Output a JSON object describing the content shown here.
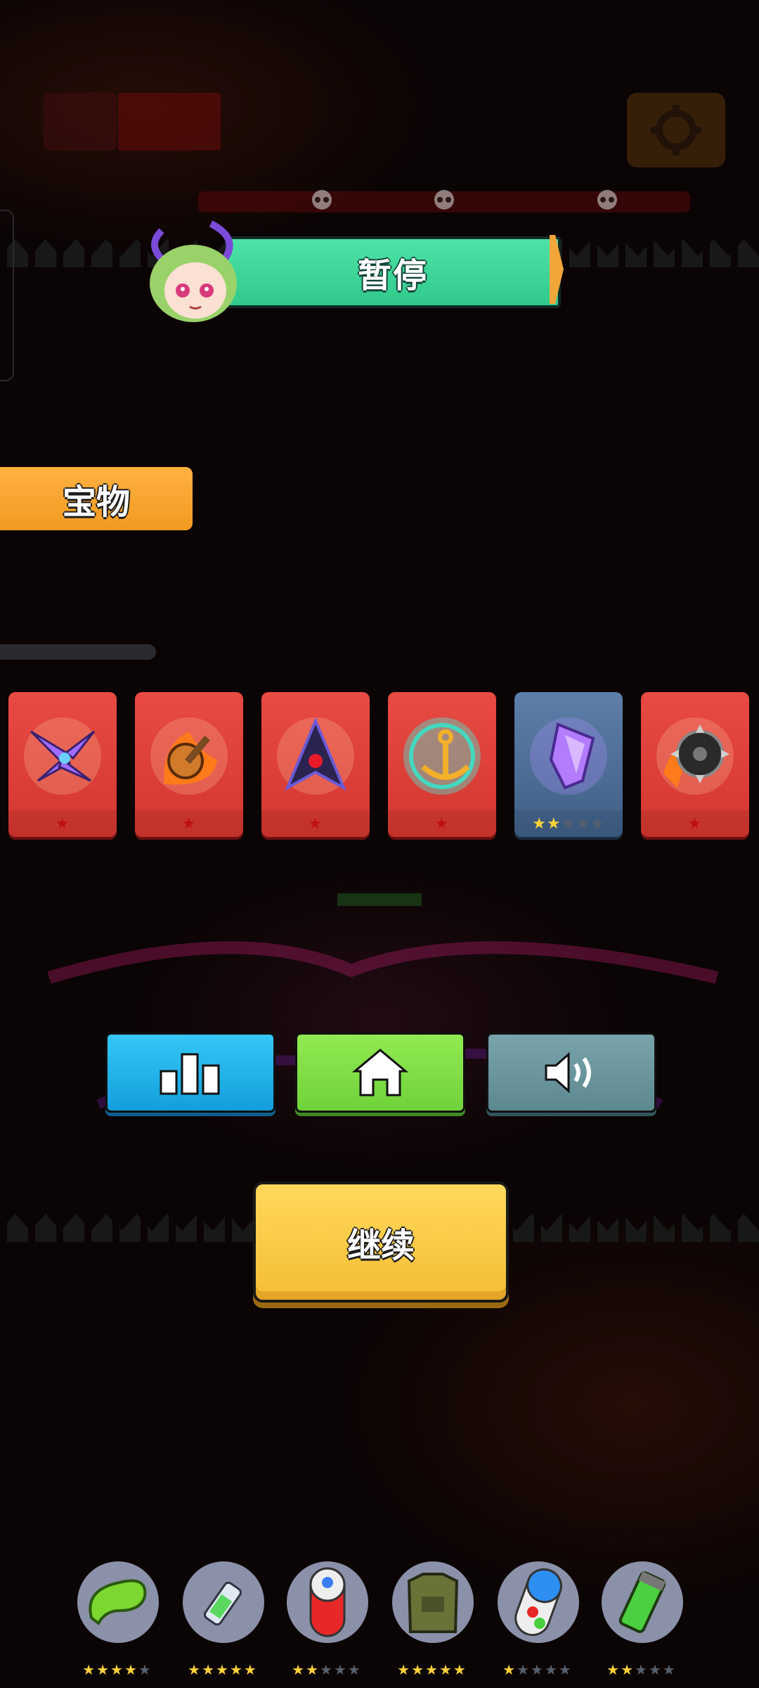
{
  "pause": {
    "title": "暂停"
  },
  "treasure": {
    "tab_label": "宝物"
  },
  "treasure_cards": [
    {
      "name": "purple-claw-icon",
      "stars": 1,
      "max_stars": 1,
      "rarity": "common",
      "accent": "#a06cff"
    },
    {
      "name": "fire-mace-icon",
      "stars": 1,
      "max_stars": 1,
      "rarity": "common",
      "accent": "#ff8a20"
    },
    {
      "name": "dark-spear-icon",
      "stars": 1,
      "max_stars": 1,
      "rarity": "common",
      "accent": "#3a2a60"
    },
    {
      "name": "anchor-icon",
      "stars": 1,
      "max_stars": 1,
      "rarity": "common",
      "accent": "#f2b02a"
    },
    {
      "name": "purple-crystal-icon",
      "stars": 2,
      "max_stars": 5,
      "rarity": "epic",
      "accent": "#b37cff"
    },
    {
      "name": "spiked-wheel-icon",
      "stars": 1,
      "max_stars": 1,
      "rarity": "common",
      "accent": "#3a3a3a"
    }
  ],
  "controls": {
    "rank": "bar-chart-icon",
    "home": "home-icon",
    "sound": "speaker-icon"
  },
  "continue": {
    "label": "继续"
  },
  "items": [
    {
      "name": "green-bean-icon",
      "stars": 4,
      "max_stars": 5
    },
    {
      "name": "syringe-icon",
      "stars": 5,
      "max_stars": 5
    },
    {
      "name": "red-capsule-icon",
      "stars": 2,
      "max_stars": 5
    },
    {
      "name": "armor-vest-icon",
      "stars": 5,
      "max_stars": 5
    },
    {
      "name": "blue-capsule-icon",
      "stars": 1,
      "max_stars": 5
    },
    {
      "name": "green-canister-icon",
      "stars": 2,
      "max_stars": 5
    }
  ],
  "colors": {
    "pause_banner": "#31c98b",
    "treasure_tab": "#f29a20",
    "continue_button": "#f5bd34",
    "rank_button": "#139edc",
    "home_button": "#6fd23a",
    "sound_button": "#5c8890"
  }
}
